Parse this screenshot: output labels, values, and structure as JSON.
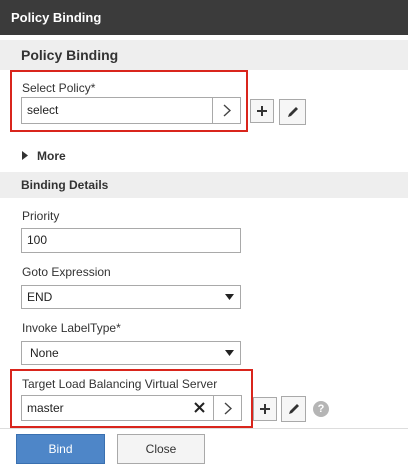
{
  "window": {
    "title": "Policy Binding"
  },
  "section_policy": {
    "heading": "Policy Binding",
    "select_label": "Select Policy*",
    "select_value": "select"
  },
  "more": {
    "label": "More"
  },
  "binding_details": {
    "heading": "Binding Details",
    "priority_label": "Priority",
    "priority_value": "100",
    "goto_label": "Goto Expression",
    "goto_value": "END",
    "invoke_label": "Invoke LabelType*",
    "invoke_value": "None",
    "target_label": "Target Load Balancing Virtual Server",
    "target_value": "master"
  },
  "buttons": {
    "bind": "Bind",
    "close": "Close"
  },
  "icons": [
    "chevron-right-icon",
    "plus-icon",
    "pencil-icon",
    "clear-x-icon",
    "help-icon",
    "dropdown-arrow-icon",
    "triangle-expand-icon"
  ],
  "colors": {
    "titlebar": "#3b3b3b",
    "highlight": "#d9251c",
    "primary_button": "#4e86c8"
  }
}
